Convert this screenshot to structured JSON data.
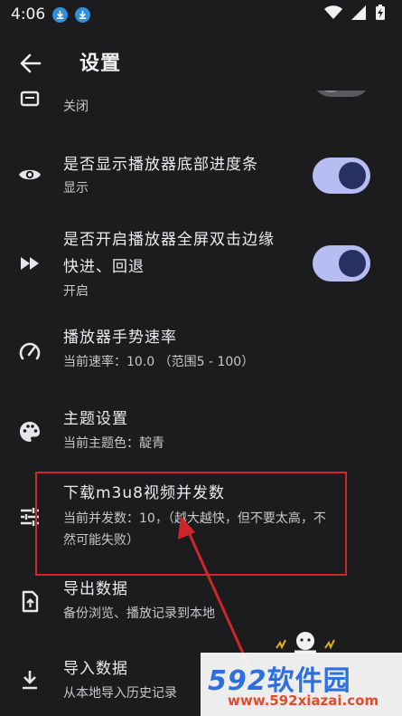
{
  "status_bar": {
    "time": "4:06"
  },
  "app_bar": {
    "title": "设置"
  },
  "settings": [
    {
      "title": "",
      "subtitle": "关闭"
    },
    {
      "title": "是否显示播放器底部进度条",
      "subtitle": "显示"
    },
    {
      "title_line1": "是否开启播放器全屏双击边缘",
      "title_line2": "快进、回退",
      "subtitle": "开启"
    },
    {
      "title": "播放器手势速率",
      "subtitle": "当前速率：10.0 （范围5 - 100）"
    },
    {
      "title": "主题设置",
      "subtitle": "当前主题色：靛青"
    },
    {
      "title": "下载m3u8视频并发数",
      "subtitle_line1": "当前并发数：10，（越大越快，但不要太高，不",
      "subtitle_line2": "然可能失败）"
    },
    {
      "title": "导出数据",
      "subtitle": "备份浏览、播放记录到本地"
    },
    {
      "title": "导入数据",
      "subtitle": "从本地导入历史记录"
    }
  ],
  "watermark": {
    "brand_num": "592",
    "brand_text": "软件园",
    "url": "www.592xiazai.com"
  },
  "colors": {
    "background": "#1c1c1e",
    "toggle_track": "#b7bdf2",
    "toggle_knob": "#263062",
    "highlight": "#d0262b"
  }
}
